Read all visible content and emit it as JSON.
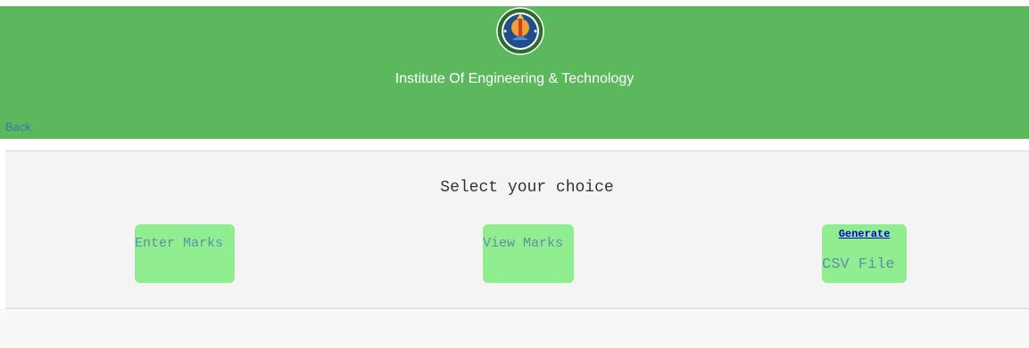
{
  "header": {
    "institute_name": "Institute Of Engineering & Technology",
    "back_label": "Back",
    "logo_icon": "university-seal-icon",
    "background_color": "#5cb85c"
  },
  "main": {
    "heading": "Select your choice",
    "choices": [
      {
        "label": "Enter Marks"
      },
      {
        "label": "View Marks"
      },
      {
        "link_label": "Generate",
        "label": "CSV File"
      }
    ],
    "button_color": "#90ee90",
    "button_text_color": "#5f8fa8"
  }
}
